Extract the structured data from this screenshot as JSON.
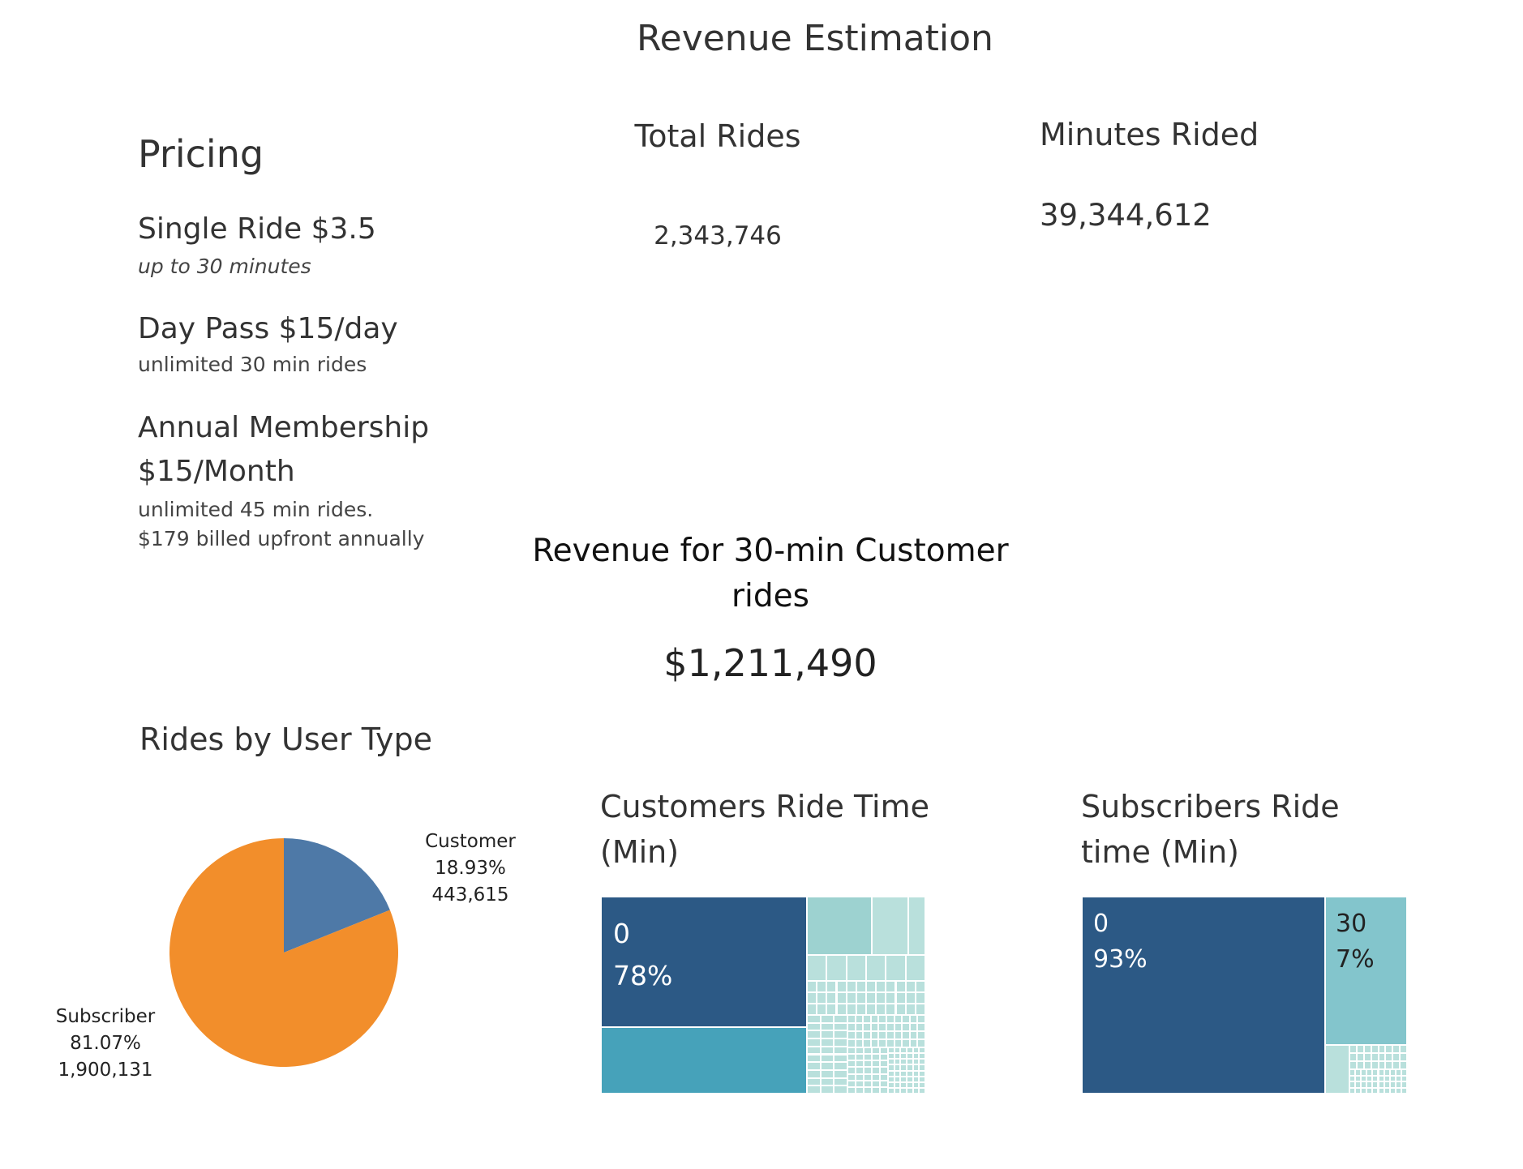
{
  "title": "Revenue Estimation",
  "pricing": {
    "heading": "Pricing",
    "single": {
      "name": "Single Ride $3.5",
      "note": "up to 30 minutes"
    },
    "day": {
      "name": "Day Pass $15/day",
      "note": "unlimited 30 min rides"
    },
    "annual": {
      "name_line1": "Annual Membership",
      "name_line2": "$15/Month",
      "note1": "unlimited 45 min rides.",
      "note2": "$179 billed upfront annually"
    }
  },
  "kpis": {
    "total_rides": {
      "label": "Total Rides",
      "value": "2,343,746"
    },
    "minutes_rided": {
      "label": "Minutes Rided",
      "value": "39,344,612"
    },
    "revenue": {
      "label_line1": "Revenue for 30-min Customer",
      "label_line2": "rides",
      "value": "$1,211,490"
    }
  },
  "colors": {
    "customer": "#4e79a7",
    "subscriber": "#f28e2b",
    "treemap_dark": "#2c5985",
    "treemap_mid": "#46a2ba",
    "treemap_light": "#83c5cc",
    "treemap_pale": "#9dd2d0",
    "treemap_paler": "#b9e0dc"
  },
  "chart_data": [
    {
      "type": "pie",
      "title": "Rides by User Type",
      "slices": [
        {
          "name": "Customer",
          "percent": "18.93%",
          "value": 443615,
          "value_label": "443,615"
        },
        {
          "name": "Subscriber",
          "percent": "81.07%",
          "value": 1900131,
          "value_label": "1,900,131"
        }
      ]
    },
    {
      "type": "treemap",
      "title_line1": "Customers Ride Time",
      "title_line2": "(Min)",
      "labeled": [
        {
          "name": "0",
          "percent": "78%"
        }
      ],
      "approx_shares": [
        0.78,
        0.11,
        0.04,
        0.02,
        0.01,
        0.04
      ]
    },
    {
      "type": "treemap",
      "title_line1": "Subscribers Ride",
      "title_line2": "time (Min)",
      "labeled": [
        {
          "name": "0",
          "percent": "93%"
        },
        {
          "name": "30",
          "percent": "7%"
        }
      ],
      "approx_shares": [
        0.93,
        0.05,
        0.02
      ]
    }
  ]
}
